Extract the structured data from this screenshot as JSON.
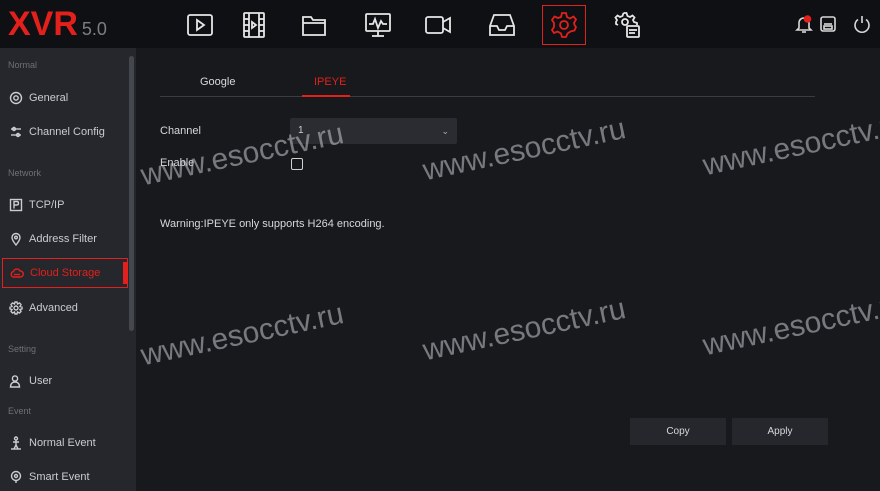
{
  "app": {
    "brand": "XVR",
    "version": "5.0"
  },
  "topnav": [
    {
      "name": "playback-icon"
    },
    {
      "name": "video-clip-icon"
    },
    {
      "name": "folder-icon"
    },
    {
      "name": "system-info-icon"
    },
    {
      "name": "camera-icon"
    },
    {
      "name": "storage-icon"
    },
    {
      "name": "settings-icon",
      "active": true
    },
    {
      "name": "advanced-settings-icon"
    }
  ],
  "sidebar": {
    "sections": {
      "normal": "Normal",
      "network": "Network",
      "setting": "Setting",
      "event": "Event"
    },
    "items": {
      "general": "General",
      "channel_config": "Channel Config",
      "tcpip": "TCP/IP",
      "address_filter": "Address Filter",
      "cloud_storage": "Cloud Storage",
      "advanced": "Advanced",
      "user": "User",
      "normal_event": "Normal Event",
      "smart_event": "Smart Event"
    },
    "active_item": "cloud_storage"
  },
  "tabs": {
    "google": "Google",
    "ipeye": "IPEYE",
    "active": "ipeye"
  },
  "form": {
    "channel_label": "Channel",
    "channel_value": "1",
    "enable_label": "Enable",
    "enable_checked": false,
    "warning": "Warning:IPEYE only supports H264 encoding."
  },
  "buttons": {
    "copy": "Copy",
    "apply": "Apply"
  },
  "watermark": "www.esocctv.ru",
  "colors": {
    "accent": "#e3201b",
    "background": "#17191d",
    "sidebar": "#25272c"
  }
}
